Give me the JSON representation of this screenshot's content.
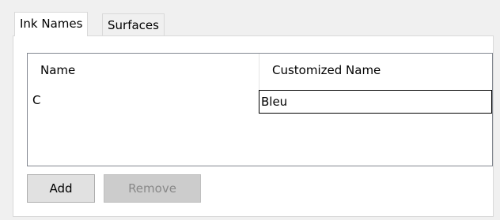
{
  "tabs": [
    {
      "label": "Ink Names",
      "active": true
    },
    {
      "label": "Surfaces",
      "active": false
    }
  ],
  "table": {
    "columns": [
      "Name",
      "Customized Name"
    ],
    "rows": [
      {
        "name": "C",
        "customized_name": "Bleu"
      }
    ]
  },
  "buttons": {
    "add_label": "Add",
    "remove_label": "Remove",
    "remove_disabled": true
  }
}
